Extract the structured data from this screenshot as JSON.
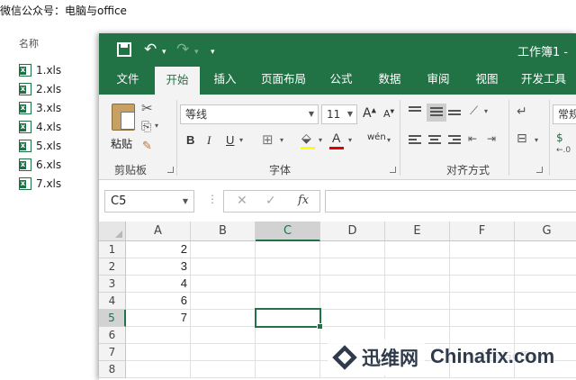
{
  "explorer": {
    "header_text": "微信公众号：电脑与office",
    "column_name": "名称",
    "files": [
      "1.xls",
      "2.xls",
      "3.xls",
      "4.xls",
      "5.xls",
      "6.xls",
      "7.xls"
    ]
  },
  "excel": {
    "window_title": "工作簿1 -",
    "qat": {
      "save_icon": "save-icon",
      "undo_icon": "undo-icon",
      "redo_icon": "redo-icon"
    },
    "tabs": [
      "文件",
      "开始",
      "插入",
      "页面布局",
      "公式",
      "数据",
      "审阅",
      "视图",
      "开发工具"
    ],
    "active_tab": "开始",
    "ribbon": {
      "clipboard": {
        "paste_label": "粘贴",
        "group_label": "剪贴板"
      },
      "font": {
        "font_name": "等线",
        "font_size": "11",
        "grow_label": "A",
        "shrink_label": "A",
        "bold_label": "B",
        "italic_label": "I",
        "underline_label": "U",
        "phonetic_label": "wén",
        "font_color_label": "A",
        "group_label": "字体"
      },
      "alignment": {
        "group_label": "对齐方式"
      },
      "number": {
        "format_label": "常规"
      }
    },
    "name_box": "C5",
    "fx_label": "fx",
    "formula_value": "",
    "columns": [
      "A",
      "B",
      "C",
      "D",
      "E",
      "F",
      "G"
    ],
    "rows": [
      "1",
      "2",
      "3",
      "4",
      "5",
      "6",
      "7",
      "8"
    ],
    "cells": {
      "A1": "2",
      "A2": "3",
      "A3": "4",
      "A4": "6",
      "A5": "7"
    },
    "selected_cell": "C5"
  },
  "watermark": {
    "faint_text": "电脑与office",
    "logo_cn": "迅维网",
    "logo_en": "Chinafix.com"
  }
}
